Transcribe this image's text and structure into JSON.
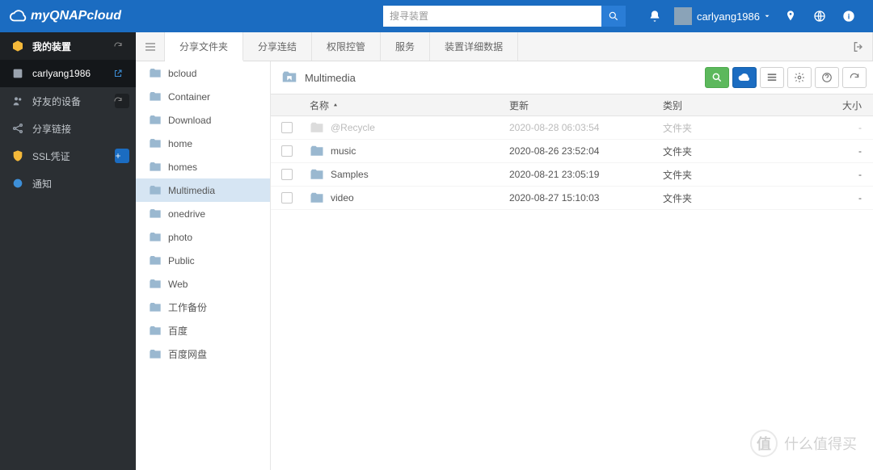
{
  "header": {
    "brand": "myQNAPcloud",
    "search_placeholder": "搜寻装置",
    "user_name": "carlyang1986"
  },
  "sidebar": {
    "items": [
      {
        "label": "我的装置",
        "icon": "package"
      },
      {
        "label": "carlyang1986",
        "icon": "nas",
        "active": true
      },
      {
        "label": "好友的设备",
        "icon": "friends"
      },
      {
        "label": "分享链接",
        "icon": "share"
      },
      {
        "label": "SSL凭证",
        "icon": "shield"
      },
      {
        "label": "通知",
        "icon": "notify"
      }
    ]
  },
  "tabs": [
    {
      "label": "分享文件夹",
      "active": true
    },
    {
      "label": "分享连结"
    },
    {
      "label": "权限控管"
    },
    {
      "label": "服务"
    },
    {
      "label": "装置详细数据"
    }
  ],
  "folder_tree": [
    {
      "label": "bcloud"
    },
    {
      "label": "Container"
    },
    {
      "label": "Download"
    },
    {
      "label": "home"
    },
    {
      "label": "homes"
    },
    {
      "label": "Multimedia",
      "selected": true
    },
    {
      "label": "onedrive"
    },
    {
      "label": "photo"
    },
    {
      "label": "Public"
    },
    {
      "label": "Web"
    },
    {
      "label": "工作备份"
    },
    {
      "label": "百度"
    },
    {
      "label": "百度网盘"
    }
  ],
  "breadcrumb": {
    "current": "Multimedia"
  },
  "columns": {
    "name": "名称",
    "updated": "更新",
    "type": "类别",
    "size": "大小"
  },
  "rows": [
    {
      "name": "@Recycle",
      "updated": "2020-08-28 06:03:54",
      "type": "文件夹",
      "size": "-",
      "recycled": true
    },
    {
      "name": "music",
      "updated": "2020-08-26 23:52:04",
      "type": "文件夹",
      "size": "-"
    },
    {
      "name": "Samples",
      "updated": "2020-08-21 23:05:19",
      "type": "文件夹",
      "size": "-"
    },
    {
      "name": "video",
      "updated": "2020-08-27 15:10:03",
      "type": "文件夹",
      "size": "-"
    }
  ],
  "watermark": {
    "badge": "值",
    "text": "什么值得买"
  }
}
